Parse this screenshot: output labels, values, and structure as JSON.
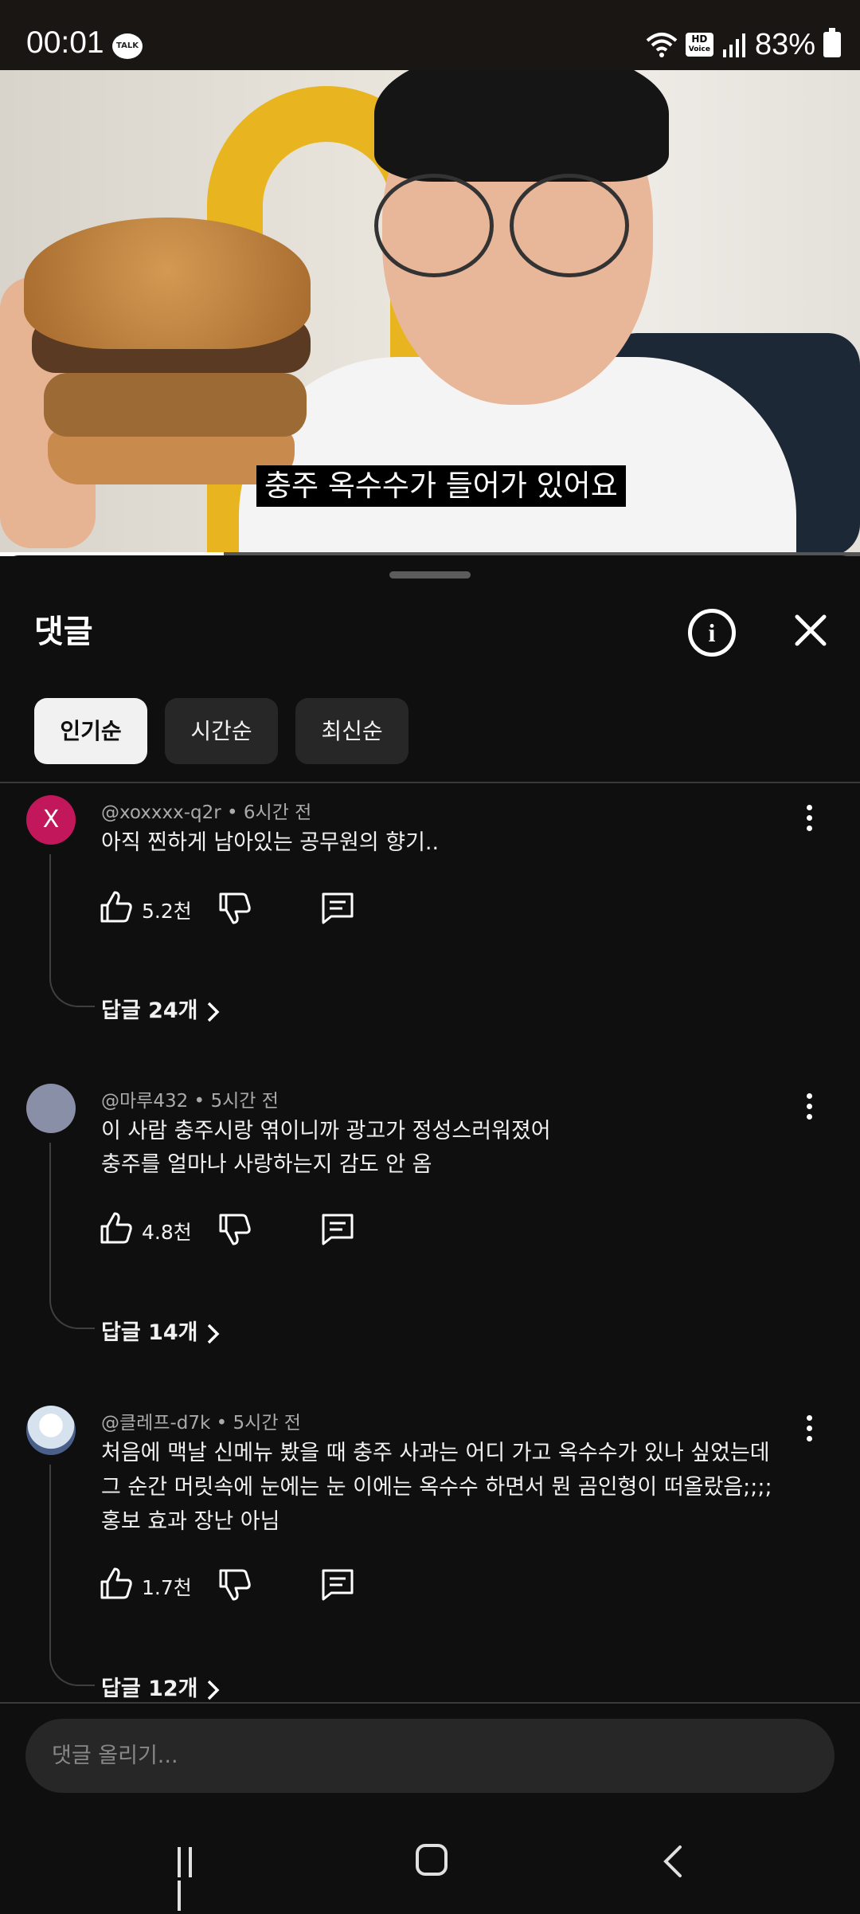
{
  "status_bar": {
    "time": "00:01",
    "talk_badge": "TALK",
    "hd_label": "HD",
    "voice_label": "Voice",
    "battery": "83%"
  },
  "video": {
    "subtitle": "충주 옥수수가 들어가 있어요",
    "progress": 0.26
  },
  "panel": {
    "title": "댓글",
    "sort_chips": [
      "인기순",
      "시간순",
      "최신순"
    ],
    "active_chip": "인기순"
  },
  "comments": [
    {
      "avatar_letter": "X",
      "avatar_color": "#c2185b",
      "author": "@xoxxxx-q2r",
      "time": "6시간 전",
      "lines": [
        "아직 찐하게 남아있는 공무원의 향기.."
      ],
      "likes": "5.2천",
      "replies": "답글 24개"
    },
    {
      "avatar_letter": "",
      "avatar_color": "#8a8fa8",
      "author": "@마루432",
      "time": "5시간 전",
      "lines": [
        "이 사람 충주시랑 엮이니까 광고가 정성스러워졌어",
        "충주를 얼마나 사랑하는지 감도 안 옴"
      ],
      "likes": "4.8천",
      "replies": "답글 14개"
    },
    {
      "avatar_letter": "",
      "avatar_color": "#d7e2ef",
      "author": "@클레프-d7k",
      "time": "5시간 전",
      "lines": [
        "처음에 맥날 신메뉴 봤을 때 충주 사과는 어디 가고 옥수수가 있나 싶었는데",
        "그 순간 머릿속에 눈에는 눈 이에는 옥수수 하면서 뭔 곰인형이 떠올랐음;;;;",
        "홍보 효과 장난 아님"
      ],
      "likes": "1.7천",
      "replies": "답글 12개"
    }
  ],
  "input": {
    "placeholder": "댓글 올리기..."
  }
}
